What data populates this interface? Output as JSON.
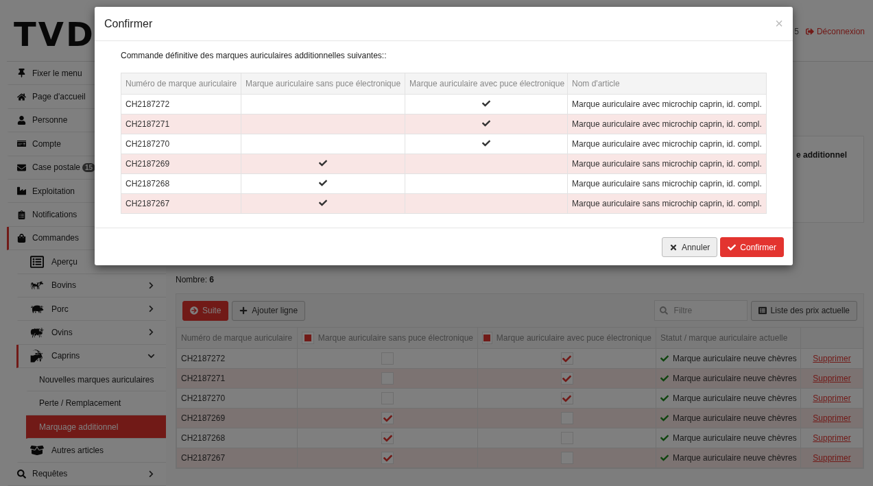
{
  "header": {
    "logo": "TVD",
    "user_fragment": "5",
    "logout": "Déconnexion"
  },
  "sidebar": {
    "items": [
      {
        "label": "Fixer le menu",
        "kind": "link",
        "selected": false
      },
      {
        "label": "Page d'accueil",
        "kind": "link",
        "selected": false
      },
      {
        "label": "Personne",
        "kind": "link",
        "selected": false
      },
      {
        "label": "Compte",
        "kind": "link",
        "selected": false
      },
      {
        "label": "Case postale",
        "badge": "15",
        "kind": "link",
        "selected": false
      },
      {
        "label": "Exploitation",
        "kind": "link",
        "selected": false
      },
      {
        "label": "Notifications",
        "kind": "link",
        "selected": false
      },
      {
        "label": "Commandes",
        "kind": "link",
        "expanded": true,
        "selected": false,
        "children": [
          {
            "label": "Aperçu",
            "kind": "link",
            "selected": false
          },
          {
            "label": "Bovins",
            "kind": "folder",
            "expanded": false,
            "selected": false
          },
          {
            "label": "Porc",
            "kind": "folder",
            "expanded": false,
            "selected": false
          },
          {
            "label": "Ovins",
            "kind": "folder",
            "expanded": false,
            "selected": false
          },
          {
            "label": "Caprins",
            "kind": "folder",
            "expanded": true,
            "selected": false,
            "children": [
              {
                "label": "Nouvelles marques auriculaires",
                "selected": false
              },
              {
                "label": "Perte / Remplacement",
                "selected": false
              },
              {
                "label": "Marquage additionnel",
                "selected": true
              }
            ]
          },
          {
            "label": "Autres articles",
            "kind": "link",
            "selected": false
          }
        ]
      },
      {
        "label": "Requêtes",
        "kind": "folder",
        "expanded": false,
        "selected": false
      }
    ]
  },
  "info_card": {
    "heading_fragment": "e additionnel"
  },
  "count": "Nombre: **6**",
  "toolbar": {
    "next": "Suite",
    "add_row": "Ajouter ligne",
    "filter_placeholder": "Filtre",
    "price_list": "Liste des prix actuelle"
  },
  "table": {
    "columns": [
      {
        "label": "Numéro de marque auriculaire"
      },
      {
        "label": "Marque auriculaire sans puce électronique",
        "indeterminate": true
      },
      {
        "label": "Marque auriculaire avec puce électronique",
        "indeterminate": true
      },
      {
        "label": "Statut / marque auriculaire actuelle"
      }
    ],
    "rows": [
      {
        "number": "CH2187272",
        "without_chip": false,
        "with_chip": true,
        "status": "Marque auriculaire neuve chèvres",
        "action": "Supprimer"
      },
      {
        "number": "CH2187271",
        "without_chip": false,
        "with_chip": true,
        "status": "Marque auriculaire neuve chèvres",
        "action": "Supprimer"
      },
      {
        "number": "CH2187270",
        "without_chip": false,
        "with_chip": true,
        "status": "Marque auriculaire neuve chèvres",
        "action": "Supprimer"
      },
      {
        "number": "CH2187269",
        "without_chip": true,
        "with_chip": false,
        "status": "Marque auriculaire neuve chèvres",
        "action": "Supprimer"
      },
      {
        "number": "CH2187268",
        "without_chip": true,
        "with_chip": false,
        "status": "Marque auriculaire neuve chèvres",
        "action": "Supprimer"
      },
      {
        "number": "CH2187267",
        "without_chip": true,
        "with_chip": false,
        "status": "Marque auriculaire neuve chèvres",
        "action": "Supprimer"
      }
    ]
  },
  "modal": {
    "title": "Confirmer",
    "close": "×",
    "message": "Commande définitive des marques auriculaires additionnelles suivantes::",
    "columns": [
      "Numéro de marque auriculaire",
      "Marque auriculaire sans puce électronique",
      "Marque auriculaire avec puce électronique",
      "Nom d'article"
    ],
    "rows": [
      {
        "number": "CH2187272",
        "without_chip": false,
        "with_chip": true,
        "article": "Marque auriculaire avec microchip caprin, id. compl."
      },
      {
        "number": "CH2187271",
        "without_chip": false,
        "with_chip": true,
        "article": "Marque auriculaire avec microchip caprin, id. compl."
      },
      {
        "number": "CH2187270",
        "without_chip": false,
        "with_chip": true,
        "article": "Marque auriculaire avec microchip caprin, id. compl."
      },
      {
        "number": "CH2187269",
        "without_chip": true,
        "with_chip": false,
        "article": "Marque auriculaire sans microchip caprin, id. compl."
      },
      {
        "number": "CH2187268",
        "without_chip": true,
        "with_chip": false,
        "article": "Marque auriculaire sans microchip caprin, id. compl."
      },
      {
        "number": "CH2187267",
        "without_chip": true,
        "with_chip": false,
        "article": "Marque auriculaire sans microchip caprin, id. compl."
      }
    ],
    "cancel": "Annuler",
    "confirm": "Confirmer"
  }
}
